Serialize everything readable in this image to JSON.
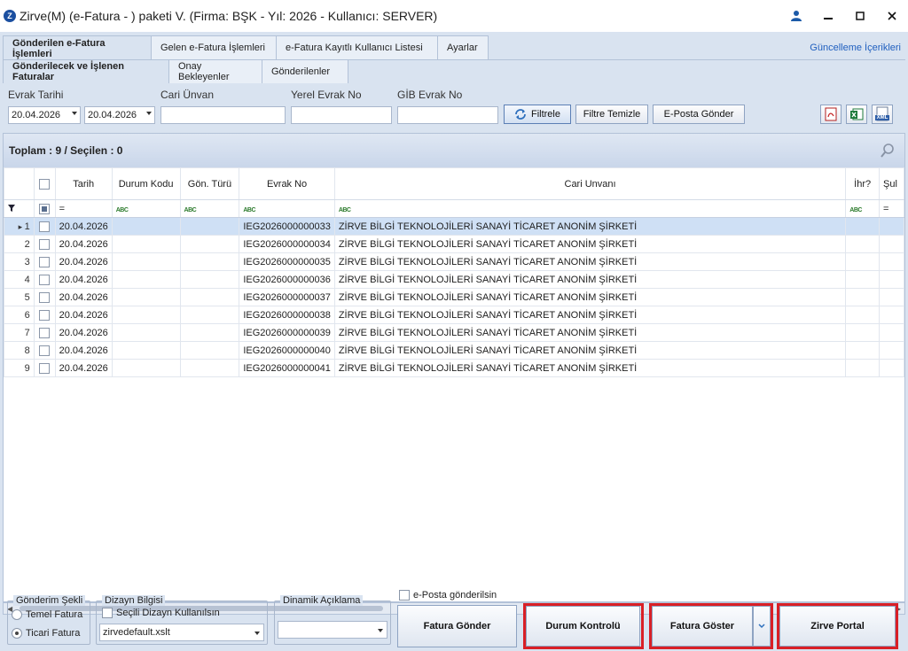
{
  "window": {
    "title": "Zirve(M)  (e-Fatura - ) paketi V. (Firma: BŞK - Yıl: 2026 - Kullanıcı: SERVER)",
    "app_icon_letter": "Z"
  },
  "main_tabs": [
    {
      "label": "Gönderilen e-Fatura İşlemleri"
    },
    {
      "label": "Gelen e-Fatura İşlemleri"
    },
    {
      "label": "e-Fatura Kayıtlı Kullanıcı Listesi"
    },
    {
      "label": "Ayarlar"
    }
  ],
  "update_link": "Güncelleme İçerikleri",
  "sub_tabs": [
    {
      "label": "Gönderilecek ve İşlenen Faturalar"
    },
    {
      "label": "Onay Bekleyenler"
    },
    {
      "label": "Gönderilenler"
    }
  ],
  "filter": {
    "evrak_tarihi_label": "Evrak Tarihi",
    "date_from": "20.04.2026",
    "date_to": "20.04.2026",
    "cari_unvan_label": "Cari Ünvan",
    "yerel_evrak_label": "Yerel Evrak No",
    "gib_evrak_label": "GİB Evrak No",
    "filtrele": "Filtrele",
    "filtre_temizle": "Filtre Temizle",
    "eposta_gonder": "E-Posta Gönder",
    "xml_label": "XML"
  },
  "grid": {
    "summary": "Toplam : 9 / Seçilen : 0",
    "columns": [
      "Tarih",
      "Durum Kodu",
      "Gön. Türü",
      "Evrak No",
      "Cari Unvanı",
      "İhr?",
      "Şul"
    ],
    "equals": "=",
    "abc": "ABC",
    "rows": [
      {
        "no": "1",
        "tarih": "20.04.2026",
        "evrak": "IEG2026000000033",
        "cari": "ZİRVE BİLGİ TEKNOLOJİLERİ SANAYİ TİCARET ANONİM ŞİRKETİ"
      },
      {
        "no": "2",
        "tarih": "20.04.2026",
        "evrak": "IEG2026000000034",
        "cari": "ZİRVE BİLGİ TEKNOLOJİLERİ SANAYİ TİCARET ANONİM ŞİRKETİ"
      },
      {
        "no": "3",
        "tarih": "20.04.2026",
        "evrak": "IEG2026000000035",
        "cari": "ZİRVE BİLGİ TEKNOLOJİLERİ SANAYİ TİCARET ANONİM ŞİRKETİ"
      },
      {
        "no": "4",
        "tarih": "20.04.2026",
        "evrak": "IEG2026000000036",
        "cari": "ZİRVE BİLGİ TEKNOLOJİLERİ SANAYİ TİCARET ANONİM ŞİRKETİ"
      },
      {
        "no": "5",
        "tarih": "20.04.2026",
        "evrak": "IEG2026000000037",
        "cari": "ZİRVE BİLGİ TEKNOLOJİLERİ SANAYİ TİCARET ANONİM ŞİRKETİ"
      },
      {
        "no": "6",
        "tarih": "20.04.2026",
        "evrak": "IEG2026000000038",
        "cari": "ZİRVE BİLGİ TEKNOLOJİLERİ SANAYİ TİCARET ANONİM ŞİRKETİ"
      },
      {
        "no": "7",
        "tarih": "20.04.2026",
        "evrak": "IEG2026000000039",
        "cari": "ZİRVE BİLGİ TEKNOLOJİLERİ SANAYİ TİCARET ANONİM ŞİRKETİ"
      },
      {
        "no": "8",
        "tarih": "20.04.2026",
        "evrak": "IEG2026000000040",
        "cari": "ZİRVE BİLGİ TEKNOLOJİLERİ SANAYİ TİCARET ANONİM ŞİRKETİ"
      },
      {
        "no": "9",
        "tarih": "20.04.2026",
        "evrak": "IEG2026000000041",
        "cari": "ZİRVE BİLGİ TEKNOLOJİLERİ SANAYİ TİCARET ANONİM ŞİRKETİ"
      }
    ]
  },
  "bottom": {
    "gonderim_sekli_label": "Gönderim Şekli",
    "temel_fatura": "Temel Fatura",
    "ticari_fatura": "Ticari Fatura",
    "dizayn_label": "Dizayn Bilgisi",
    "secili_dizayn": "Seçili Dizayn Kullanılsın",
    "dizayn_value": "zirvedefault.xslt",
    "dinamik_label": "Dinamik Açıklama",
    "eposta_gonderilsin": "e-Posta gönderilsin",
    "fatura_gonder": "Fatura Gönder",
    "durum_kontrolu": "Durum Kontrolü",
    "fatura_goster": "Fatura Göster",
    "zirve_portal": "Zirve Portal"
  },
  "colors": {
    "frame_bg": "#d9e3f0",
    "selected_row": "#cfe0f5",
    "highlight_red": "#d91f26",
    "link": "#1f5fbf"
  }
}
